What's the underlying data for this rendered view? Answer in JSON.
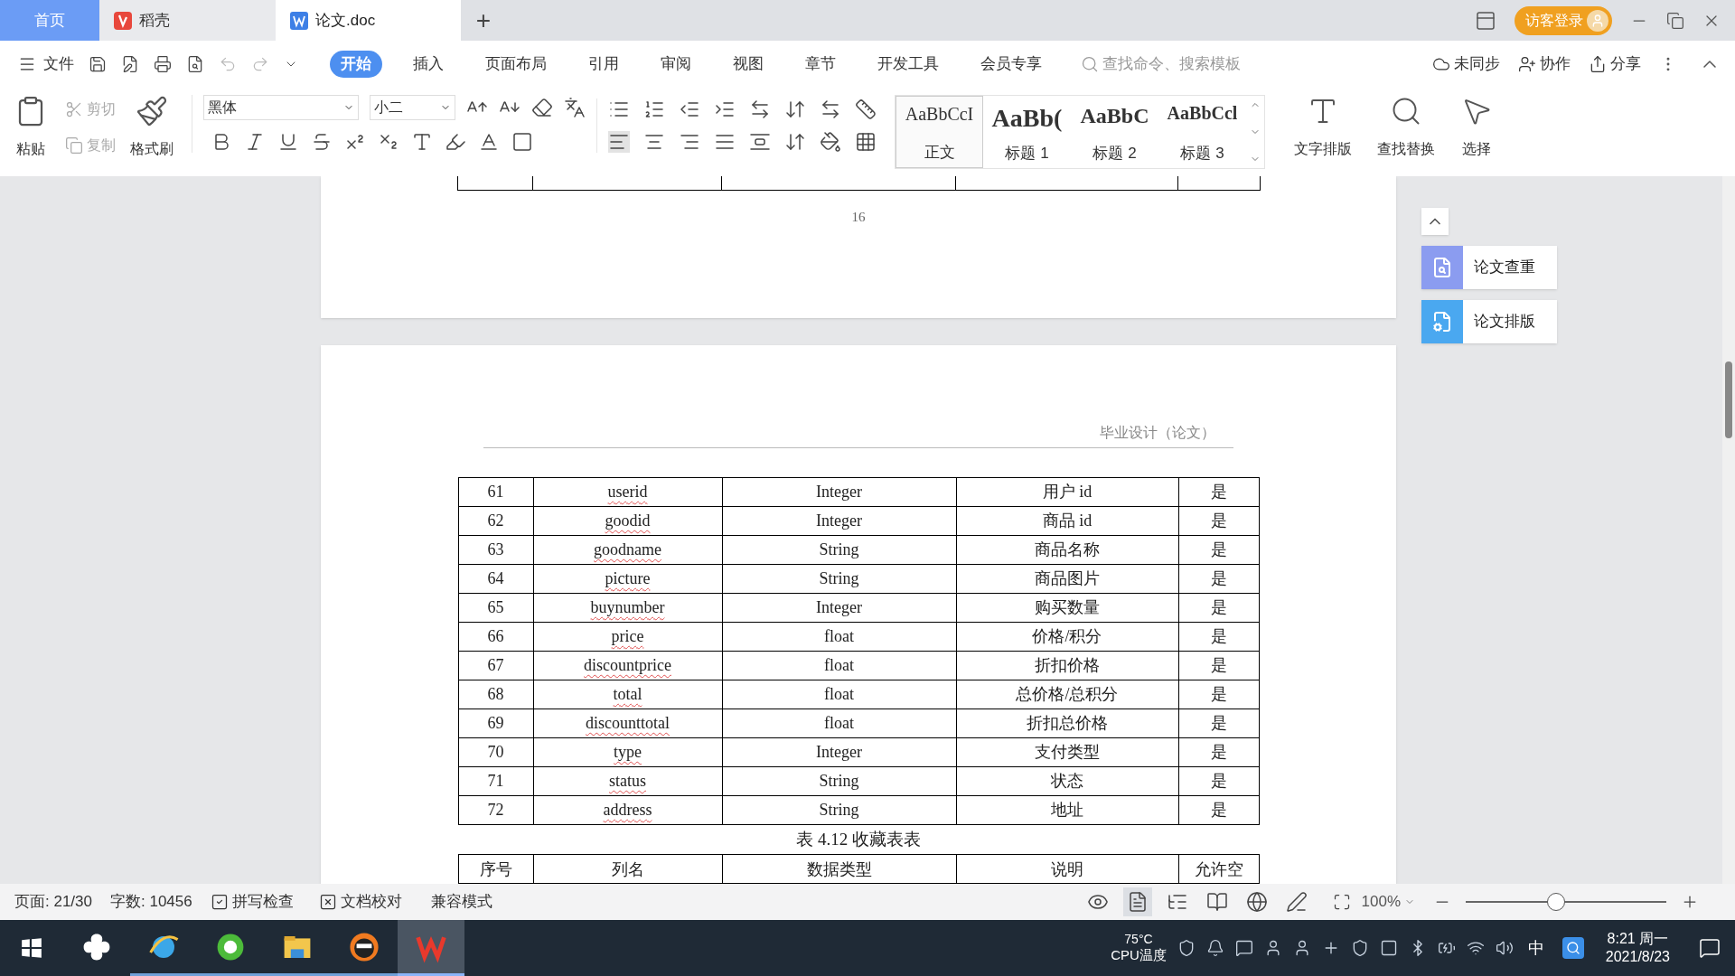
{
  "tabs": [
    {
      "label": "首页",
      "kind": "home",
      "selected": false
    },
    {
      "label": "稻壳",
      "kind": "docer",
      "selected": false
    },
    {
      "label": "论文.doc",
      "kind": "doc",
      "selected": true
    }
  ],
  "new_tab": "+",
  "login": "访客登录",
  "menu": {
    "file": "文件",
    "items": [
      {
        "label": "开始",
        "selected": true
      },
      {
        "label": "插入",
        "selected": false
      },
      {
        "label": "页面布局",
        "selected": false
      },
      {
        "label": "引用",
        "selected": false
      },
      {
        "label": "审阅",
        "selected": false
      },
      {
        "label": "视图",
        "selected": false
      },
      {
        "label": "章节",
        "selected": false
      },
      {
        "label": "开发工具",
        "selected": false
      },
      {
        "label": "会员专享",
        "selected": false
      }
    ],
    "search": {
      "placeholder": "查找命令、搜索模板"
    },
    "actions": [
      {
        "label": "未同步",
        "kind": "sync"
      },
      {
        "label": "协作",
        "kind": "collab"
      },
      {
        "label": "分享",
        "kind": "share"
      }
    ]
  },
  "ribbon": {
    "paste": "粘贴",
    "cut": {
      "label": "剪切",
      "disabled": true
    },
    "copy": {
      "label": "复制",
      "disabled": true
    },
    "format_painter": "格式刷",
    "font": {
      "value": "黑体"
    },
    "size": {
      "value": "小二"
    },
    "styles": [
      {
        "preview": "AaBbCcI",
        "label": "正文",
        "kind": "normal",
        "selected": true
      },
      {
        "preview": "AaBb(",
        "label": "标题 1",
        "kind": "h1",
        "selected": false
      },
      {
        "preview": "AaBbC",
        "label": "标题 2",
        "kind": "h2",
        "selected": false
      },
      {
        "preview": "AaBbCcl",
        "label": "标题 3",
        "kind": "h3",
        "selected": false
      }
    ],
    "big_buttons": [
      {
        "label": "文字排版",
        "kind": "layout"
      },
      {
        "label": "查找替换",
        "kind": "find"
      },
      {
        "label": "选择",
        "kind": "select"
      }
    ]
  },
  "document": {
    "page_number": "16",
    "header": "毕业设计（论文）",
    "rows": [
      {
        "cells": [
          "61",
          "userid",
          "Integer",
          "用户 id",
          "是"
        ]
      },
      {
        "cells": [
          "62",
          "goodid",
          "Integer",
          "商品 id",
          "是"
        ]
      },
      {
        "cells": [
          "63",
          "goodname",
          "String",
          "商品名称",
          "是"
        ]
      },
      {
        "cells": [
          "64",
          "picture",
          "String",
          "商品图片",
          "是"
        ]
      },
      {
        "cells": [
          "65",
          "buynumber",
          "Integer",
          "购买数量",
          "是"
        ]
      },
      {
        "cells": [
          "66",
          "price",
          "float",
          "价格/积分",
          "是"
        ]
      },
      {
        "cells": [
          "67",
          "discountprice",
          "float",
          "折扣价格",
          "是"
        ]
      },
      {
        "cells": [
          "68",
          "total",
          "float",
          "总价格/总积分",
          "是"
        ]
      },
      {
        "cells": [
          "69",
          "discounttotal",
          "float",
          "折扣总价格",
          "是"
        ]
      },
      {
        "cells": [
          "70",
          "type",
          "Integer",
          "支付类型",
          "是"
        ]
      },
      {
        "cells": [
          "71",
          "status",
          "String",
          "状态",
          "是"
        ]
      },
      {
        "cells": [
          "72",
          "address",
          "String",
          "地址",
          "是"
        ]
      }
    ],
    "caption": "表 4.12 收藏表表",
    "next_header": [
      "序号",
      "列名",
      "数据类型",
      "说明",
      "允许空"
    ]
  },
  "side_buttons": [
    "论文查重",
    "论文排版"
  ],
  "status": {
    "page": "页面: 21/30",
    "words": "字数: 10456",
    "spell": "拼写检查",
    "proof": "文档校对",
    "mode": "兼容模式",
    "views": [
      {
        "selected": false
      },
      {
        "selected": true
      },
      {
        "selected": false
      },
      {
        "selected": false
      },
      {
        "selected": false
      },
      {
        "selected": false
      }
    ],
    "zoom": "100%",
    "zoom_slider": {
      "level": 0.45
    }
  },
  "taskbar": {
    "apps": [
      {
        "selected": false
      },
      {
        "selected": false
      },
      {
        "selected": false
      },
      {
        "selected": false
      },
      {
        "selected": false
      },
      {
        "selected": true
      }
    ],
    "temp": "75°C",
    "temp_label": "CPU温度",
    "ime": "中",
    "time": "8:21 周一",
    "date": "2021/8/23"
  }
}
